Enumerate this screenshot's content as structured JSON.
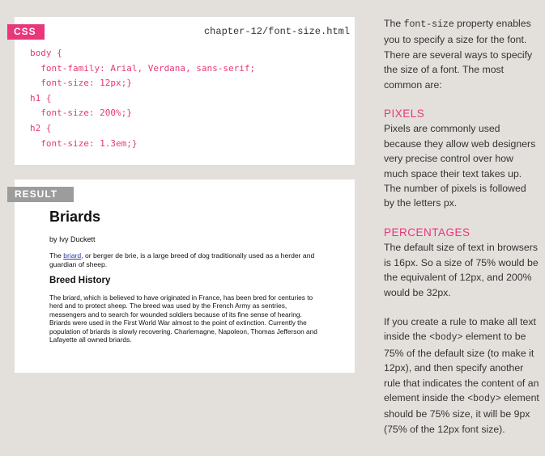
{
  "css_panel": {
    "tag": "CSS",
    "filename": "chapter-12/font-size.html",
    "code": "body {\n  font-family: Arial, Verdana, sans-serif;\n  font-size: 12px;}\nh1 {\n  font-size: 200%;}\nh2 {\n  font-size: 1.3em;}"
  },
  "result_panel": {
    "tag": "RESULT",
    "h1": "Briards",
    "byline": "by Ivy Duckett",
    "intro_pre": "The ",
    "intro_link": "briard",
    "intro_post": ", or berger de brie, is a large breed of dog traditionally used as a herder and guardian of sheep.",
    "h2": "Breed History",
    "body": "The briard, which is believed to have originated in France, has been bred for centuries to herd and to protect sheep. The breed was used by the French Army as sentries, messengers and to search for wounded soldiers because of its fine sense of hearing. Briards were used in the First World War almost to the point of extinction. Currently the population of briards is slowly recovering. Charlemagne, Napoleon, Thomas Jefferson and Lafayette all owned briards."
  },
  "sidebar": {
    "intro_pre": "The ",
    "intro_code": "font-size",
    "intro_post": " property enables you to specify a size for the font. There are several ways to specify the size of a font. The most common are:",
    "pixels_heading": "PIXELS",
    "pixels_text": "Pixels are commonly used because they allow web designers very precise control over how much space their text takes up. The number of pixels is followed by the letters px.",
    "percentages_heading": "PERCENTAGES",
    "percentages_text": "The default size of text in browsers is 16px. So a size of 75% would be the equivalent of 12px, and 200% would be 32px.",
    "rule_p1": "If you create a rule to make all text inside the ",
    "rule_code1": "<body>",
    "rule_p2": " element to be 75% of the default size (to make it 12px), and then specify another rule that indicates the content of an element inside the ",
    "rule_code2": "<body>",
    "rule_p3": " element should be 75% size, it will be 9px (75% of the 12px font size)."
  }
}
